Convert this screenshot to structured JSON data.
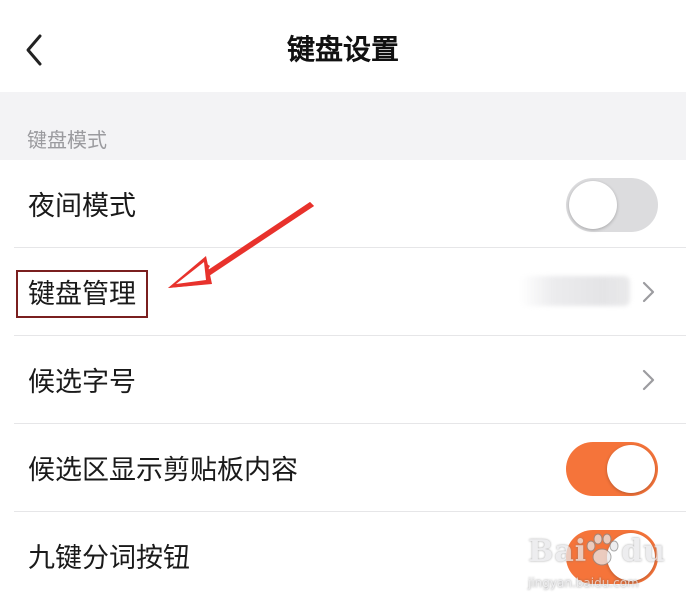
{
  "header": {
    "title": "键盘设置",
    "back_icon": "chevron-left-icon"
  },
  "section": {
    "label": "键盘模式"
  },
  "rows": [
    {
      "label": "夜间模式",
      "control": "toggle",
      "on": false
    },
    {
      "label": "键盘管理",
      "control": "chevron",
      "value_obscured": true
    },
    {
      "label": "候选字号",
      "control": "chevron"
    },
    {
      "label": "候选区显示剪贴板内容",
      "control": "toggle",
      "on": true
    },
    {
      "label": "九键分词按钮",
      "control": "toggle",
      "on": true
    }
  ],
  "watermark": {
    "brand": "Baidu经验",
    "url": "jingyan.baidu.com"
  },
  "colors": {
    "accent": "#f5743a",
    "toggle_off": "#dcdcde",
    "section_bg": "#f3f3f5",
    "annotation": "#7a1f1f",
    "arrow": "#e8322c"
  }
}
